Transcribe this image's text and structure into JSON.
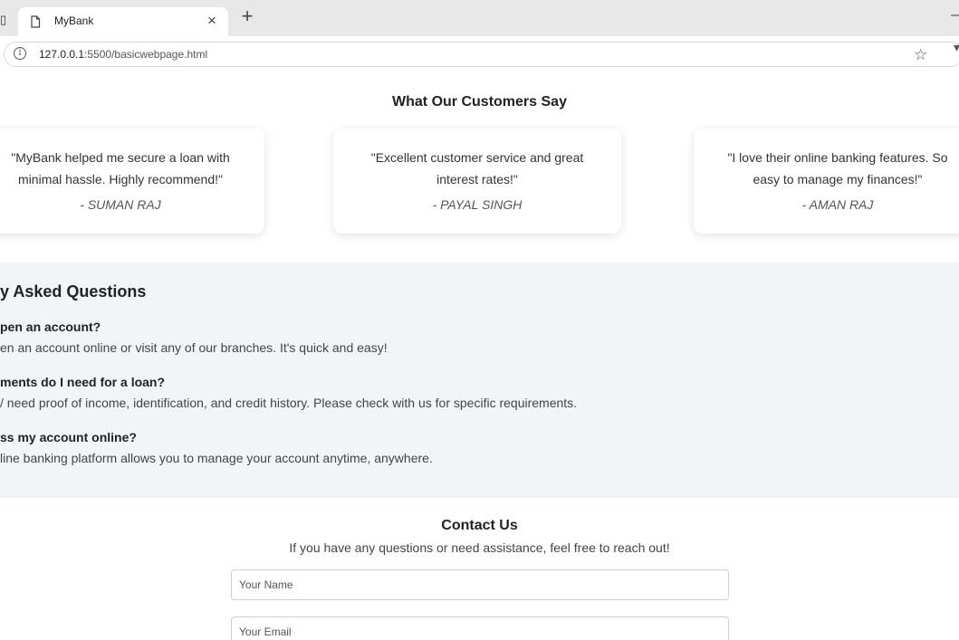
{
  "browser": {
    "tab_title": "MyBank",
    "tab_close": "×",
    "new_tab": "+",
    "url_host": "127.0.0.1",
    "url_rest": ":5500/basicwebpage.html",
    "icons": [
      "page-icon",
      "close-icon",
      "new-tab-icon",
      "info-icon",
      "star-icon"
    ]
  },
  "testimonials": {
    "title": "What Our Customers Say",
    "items": [
      {
        "quote": "\"MyBank helped me secure a loan with minimal hassle. Highly recommend!\"",
        "author": "- SUMAN RAJ"
      },
      {
        "quote": "\"Excellent customer service and great interest rates!\"",
        "author": "- PAYAL SINGH"
      },
      {
        "quote": "\"I love their online banking features. So easy to manage my finances!\"",
        "author": "- AMAN RAJ"
      }
    ]
  },
  "faq": {
    "title": "y Asked Questions",
    "items": [
      {
        "q": "pen an account?",
        "a": "en an account online or visit any of our branches. It's quick and easy!"
      },
      {
        "q": "ments do I need for a loan?",
        "a": "/ need proof of income, identification, and credit history. Please check with us for specific requirements."
      },
      {
        "q": "ss my account online?",
        "a": "line banking platform allows you to manage your account anytime, anywhere."
      }
    ]
  },
  "contact": {
    "title": "Contact Us",
    "subtitle": "If you have any questions or need assistance, feel free to reach out!",
    "name_placeholder": "Your Name",
    "email_placeholder": "Your Email"
  },
  "colors": {
    "faq_background": "#f1f5f8",
    "tabbar": "#e8e8e8"
  }
}
